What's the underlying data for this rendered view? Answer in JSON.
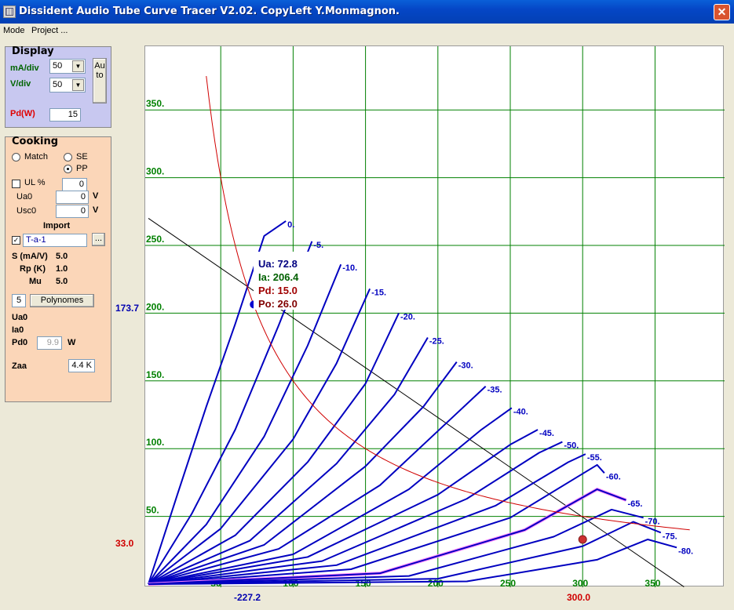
{
  "window": {
    "title": "Dissident Audio Tube Curve Tracer V2.02. CopyLeft Y.Monmagnon.",
    "close_glyph": "✕"
  },
  "menu": [
    "Mode",
    "Project ..."
  ],
  "display": {
    "title": "Display",
    "ma_div_label": "mA/div",
    "ma_div_value": "50",
    "v_div_label": "V/div",
    "v_div_value": "50",
    "auto_label": "Auto",
    "pd_label": "Pd(W)",
    "pd_value": "15"
  },
  "cooking": {
    "title": "Cooking",
    "match_label": "Match",
    "se_label": "SE",
    "pp_label": "PP",
    "selected_mode": "PP",
    "ul_label": "UL %",
    "ul_value": "0",
    "ul_checked": false,
    "ua0_label": "Ua0",
    "ua0_value": "0",
    "ua0_unit": "V",
    "usc0_label": "Usc0",
    "usc0_value": "0",
    "usc0_unit": "V",
    "import_label": "Import",
    "import_checked": true,
    "import_value": "T-a-1",
    "browse_label": "...",
    "s_label": "S (mA/V)",
    "s_value": "5.0",
    "rp_label": "Rp (K)",
    "rp_value": "1.0",
    "mu_label": "Mu",
    "mu_value": "5.0",
    "poly_count": "5",
    "poly_button": "Polynomes",
    "ua0_out_label": "Ua0",
    "ia0_out_label": "Ia0",
    "pd0_label": "Pd0",
    "pd0_value": "9.9",
    "pd0_unit": "W",
    "zaa_label": "Zaa",
    "zaa_value": "4.4 K"
  },
  "colors": {
    "grid": "#008000",
    "curves": "#0000c0",
    "hyperbola": "#d00000",
    "loadline": "#000000",
    "selected_curve": "#ff80ff"
  },
  "chart_data": {
    "type": "line",
    "title": "",
    "xlabel": "",
    "ylabel": "",
    "xlim": [
      0,
      375
    ],
    "ylim": [
      0,
      375
    ],
    "x_ticks": [
      50,
      100,
      150,
      200,
      250,
      300,
      350
    ],
    "y_ticks": [
      50,
      100,
      150,
      200,
      250,
      300,
      350
    ],
    "tick_labels_x": [
      "50",
      "100",
      "150",
      "200",
      "250",
      "300",
      "350"
    ],
    "tick_labels_y": [
      "50.",
      "100.",
      "150.",
      "200.",
      "250.",
      "300.",
      "350."
    ],
    "grid": true,
    "series": [
      {
        "name": "0.",
        "points": [
          [
            0,
            0
          ],
          [
            20,
            66
          ],
          [
            40,
            131
          ],
          [
            60,
            192
          ],
          [
            80,
            257
          ],
          [
            95,
            268
          ]
        ]
      },
      {
        "name": "-5.",
        "points": [
          [
            0,
            0
          ],
          [
            30,
            52
          ],
          [
            60,
            114
          ],
          [
            90,
            191
          ],
          [
            113,
            253
          ]
        ]
      },
      {
        "name": "-10.",
        "points": [
          [
            0,
            0
          ],
          [
            40,
            44
          ],
          [
            80,
            109
          ],
          [
            110,
            176
          ],
          [
            133,
            236
          ]
        ]
      },
      {
        "name": "-15.",
        "points": [
          [
            0,
            0
          ],
          [
            50,
            41
          ],
          [
            100,
            107
          ],
          [
            130,
            163
          ],
          [
            153,
            218
          ]
        ]
      },
      {
        "name": "-20.",
        "points": [
          [
            0,
            0
          ],
          [
            60,
            36
          ],
          [
            110,
            90
          ],
          [
            150,
            148
          ],
          [
            173,
            200
          ]
        ]
      },
      {
        "name": "-25.",
        "points": [
          [
            0,
            0
          ],
          [
            70,
            32
          ],
          [
            130,
            89
          ],
          [
            170,
            140
          ],
          [
            193,
            182
          ]
        ]
      },
      {
        "name": "-30.",
        "points": [
          [
            0,
            0
          ],
          [
            80,
            29
          ],
          [
            150,
            87
          ],
          [
            190,
            131
          ],
          [
            213,
            164
          ]
        ]
      },
      {
        "name": "-35.",
        "points": [
          [
            0,
            0
          ],
          [
            90,
            26
          ],
          [
            160,
            73
          ],
          [
            210,
            123
          ],
          [
            233,
            146
          ]
        ]
      },
      {
        "name": "-40.",
        "points": [
          [
            0,
            0
          ],
          [
            100,
            22
          ],
          [
            180,
            70
          ],
          [
            230,
            114
          ],
          [
            251,
            130
          ]
        ]
      },
      {
        "name": "-45.",
        "points": [
          [
            0,
            0
          ],
          [
            110,
            20
          ],
          [
            200,
            66
          ],
          [
            250,
            103
          ],
          [
            269,
            114
          ]
        ]
      },
      {
        "name": "-50.",
        "points": [
          [
            0,
            0
          ],
          [
            120,
            17
          ],
          [
            220,
            63
          ],
          [
            270,
            97
          ],
          [
            286,
            105
          ]
        ]
      },
      {
        "name": "-55.",
        "points": [
          [
            0,
            0
          ],
          [
            130,
            14
          ],
          [
            240,
            58
          ],
          [
            290,
            90
          ],
          [
            302,
            96
          ]
        ]
      },
      {
        "name": "-60.",
        "points": [
          [
            0,
            0
          ],
          [
            140,
            11
          ],
          [
            250,
            49
          ],
          [
            310,
            88
          ],
          [
            315,
            82
          ]
        ]
      },
      {
        "name": "-65.",
        "points": [
          [
            0,
            0
          ],
          [
            160,
            8
          ],
          [
            260,
            40
          ],
          [
            310,
            70
          ],
          [
            330,
            62
          ]
        ]
      },
      {
        "name": "-70.",
        "points": [
          [
            0,
            0
          ],
          [
            180,
            6
          ],
          [
            280,
            35
          ],
          [
            320,
            55
          ],
          [
            342,
            49
          ]
        ]
      },
      {
        "name": "-75.",
        "points": [
          [
            0,
            0
          ],
          [
            200,
            4
          ],
          [
            300,
            28
          ],
          [
            335,
            46
          ],
          [
            354,
            38
          ]
        ]
      },
      {
        "name": "-80.",
        "points": [
          [
            0,
            0
          ],
          [
            220,
            2
          ],
          [
            310,
            18
          ],
          [
            345,
            33
          ],
          [
            365,
            27
          ]
        ]
      }
    ],
    "load_line": {
      "points": [
        [
          0,
          270
        ],
        [
          370,
          -2
        ]
      ]
    },
    "pd_hyperbola_w": 15,
    "operating_point": {
      "ua": 72.8,
      "ia": 206.4
    },
    "quiescent_point": {
      "ua": 300.0,
      "ia": 33.0
    },
    "infobox": {
      "ua": "Ua: 72.8",
      "ia": "Ia: 206.4",
      "pd": "Pd: 15.0",
      "po": "Po: 26.0"
    },
    "marker_labels": {
      "y_op": "173.7",
      "y_q": "33.0",
      "x_op": "-227.2",
      "x_q": "300.0"
    }
  }
}
